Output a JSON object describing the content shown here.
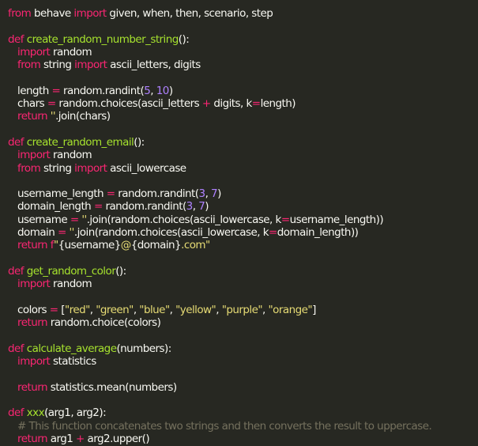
{
  "code": {
    "l1": {
      "kw1": "from",
      "mod": " behave ",
      "kw2": "import",
      "rest": " given, when, then, scenario, step"
    },
    "f1": {
      "def": "def",
      "name": "create_random_number_string",
      "sig": "():"
    },
    "f1b": {
      "i1_kw": "import",
      "i1_rest": " random",
      "i2_kw1": "from",
      "i2_mid": " string ",
      "i2_kw2": "import",
      "i2_rest": " ascii_letters, digits",
      "l_len_a": "length ",
      "l_len_eq": "=",
      "l_len_b": " random.randint(",
      "l_len_n1": "5",
      "l_len_c": ", ",
      "l_len_n2": "10",
      "l_len_d": ")",
      "l_ch_a": "chars ",
      "l_ch_eq": "=",
      "l_ch_b": " random.choices(ascii_letters ",
      "l_ch_plus": "+",
      "l_ch_c": " digits, k",
      "l_ch_eq2": "=",
      "l_ch_d": "length)",
      "ret_kw": "return",
      "ret_str": " ''",
      "ret_rest": ".join(chars)"
    },
    "f2": {
      "def": "def",
      "name": "create_random_email",
      "sig": "():"
    },
    "f2b": {
      "i1_kw": "import",
      "i1_rest": " random",
      "i2_kw1": "from",
      "i2_mid": " string ",
      "i2_kw2": "import",
      "i2_rest": " ascii_lowercase",
      "u_a": "username_length ",
      "u_eq": "=",
      "u_b": " random.randint(",
      "u_n1": "3",
      "u_c": ", ",
      "u_n2": "7",
      "u_d": ")",
      "d_a": "domain_length ",
      "d_eq": "=",
      "d_b": " random.randint(",
      "d_n1": "3",
      "d_c": ", ",
      "d_n2": "7",
      "d_d": ")",
      "un_a": "username ",
      "un_eq": "=",
      "un_str": " ''",
      "un_b": ".join(random.choices(ascii_lowercase, k",
      "un_eq2": "=",
      "un_c": "username_length))",
      "dm_a": "domain ",
      "dm_eq": "=",
      "dm_str": " ''",
      "dm_b": ".join(random.choices(ascii_lowercase, k",
      "dm_eq2": "=",
      "dm_c": "domain_length))",
      "ret_kw": "return",
      "ret_f": " f",
      "ret_s1": "\"",
      "ret_v1": "{username}",
      "ret_s2": "@",
      "ret_v2": "{domain}",
      "ret_s3": ".com\""
    },
    "f3": {
      "def": "def",
      "name": "get_random_color",
      "sig": "():"
    },
    "f3b": {
      "i1_kw": "import",
      "i1_rest": " random",
      "c_a": "colors ",
      "c_eq": "=",
      "c_b": " [",
      "c_s1": "\"red\"",
      "c_s2": "\"green\"",
      "c_s3": "\"blue\"",
      "c_s4": "\"yellow\"",
      "c_s5": "\"purple\"",
      "c_s6": "\"orange\"",
      "c_sep": ", ",
      "c_end": "]",
      "ret_kw": "return",
      "ret_rest": " random.choice(colors)"
    },
    "f4": {
      "def": "def",
      "name": "calculate_average",
      "sig": "(numbers):"
    },
    "f4b": {
      "i1_kw": "import",
      "i1_rest": " statistics",
      "ret_kw": "return",
      "ret_rest": " statistics.mean(numbers)"
    },
    "f5": {
      "def": "def",
      "name": "xxx",
      "sig": "(arg1, arg2):"
    },
    "f5b": {
      "comment": "# This function concatenates two strings and then converts the result to uppercase.",
      "ret_kw": "return",
      "ret_a": " arg1 ",
      "ret_plus": "+",
      "ret_b": " arg2.upper()"
    }
  }
}
